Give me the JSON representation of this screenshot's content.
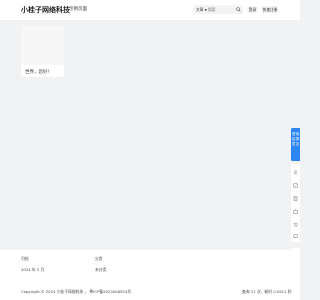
{
  "header": {
    "brand": "小桂子网络科技",
    "nav": [
      "示例页面"
    ],
    "search": {
      "category": "文章",
      "placeholder": "搜索"
    },
    "login_label": "登录",
    "register_label": "快速注册"
  },
  "main": {
    "card": {
      "caption": "世界，您好!"
    }
  },
  "side": {
    "feedback_label": [
      "咨询",
      "反馈",
      "意见"
    ]
  },
  "footer": {
    "col1": {
      "title": "归档",
      "items": [
        "2024 年 5 月"
      ]
    },
    "col2": {
      "title": "分类",
      "items": [
        "未分类"
      ]
    },
    "copyright": "Copyright © 2024 小桂子网络科技 ， 粤ICP备2023008554号",
    "stats": "查询 37 次，耗时 0.0511 秒"
  }
}
